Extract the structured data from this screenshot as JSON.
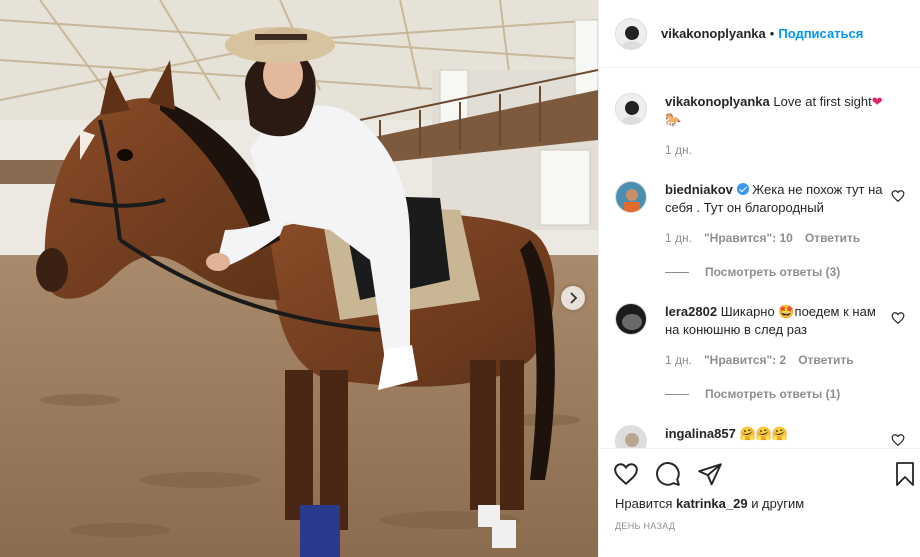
{
  "header": {
    "username": "vikakonoplyanka",
    "separator": "•",
    "follow_label": "Подписаться"
  },
  "caption": {
    "username": "vikakonoplyanka",
    "text": "Love at first sight",
    "time": "1 дн."
  },
  "comments": [
    {
      "username": "biedniakov",
      "verified": true,
      "text": "Жека не похож тут на себя . Тут он благородный",
      "time": "1 дн.",
      "likes": "\"Нравится\": 10",
      "reply": "Ответить",
      "view_replies": "Посмотреть ответы (3)"
    },
    {
      "username": "lera2802",
      "text_before": "Шикарно",
      "text_after": "поедем к нам на конюшню в след раз",
      "time": "1 дн.",
      "likes": "\"Нравится\": 2",
      "reply": "Ответить",
      "view_replies": "Посмотреть ответы (1)"
    },
    {
      "username": "ingalina857",
      "text": "🤗🤗🤗"
    }
  ],
  "footer": {
    "likes_prefix": "Нравится",
    "likes_user": "katrinka_29",
    "likes_suffix": "и другим",
    "date": "день назад"
  },
  "icons": {
    "like": "heart-icon",
    "comment": "comment-icon",
    "share": "share-icon",
    "save": "bookmark-icon",
    "next": "chevron-right-icon"
  },
  "colors": {
    "accent": "#0095f6",
    "text": "#262626",
    "muted": "#8e8e8e",
    "heart": "#ed4956"
  }
}
